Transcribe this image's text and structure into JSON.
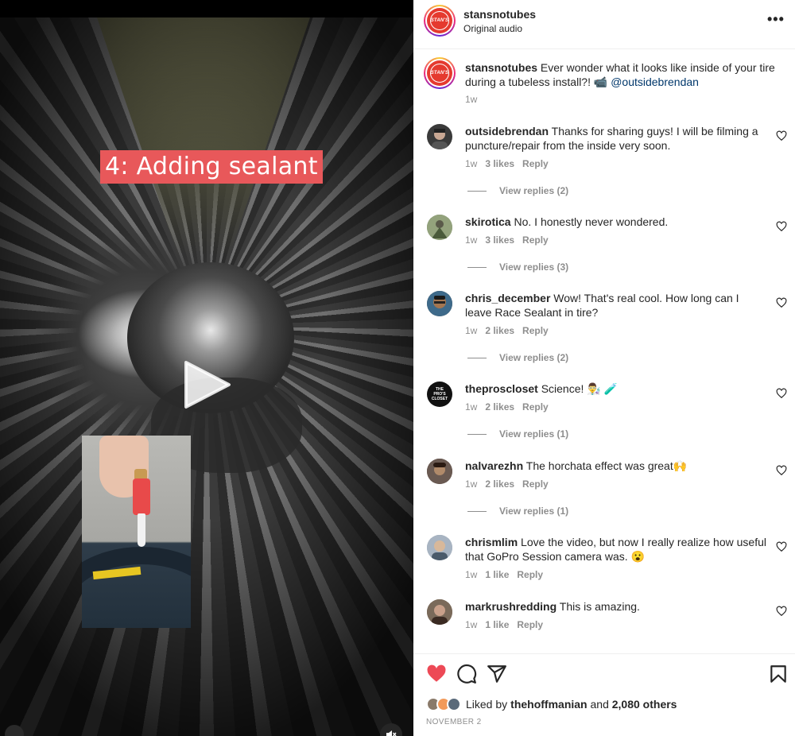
{
  "video": {
    "caption": "4: Adding sealant",
    "play_icon": "play-icon",
    "mute_icon": "mute-icon"
  },
  "header": {
    "username": "stansnotubes",
    "audio": "Original audio",
    "avatar_text": "STAN'S",
    "more_icon": "more-options-icon",
    "more_label": "•••"
  },
  "caption": {
    "username": "stansnotubes",
    "text": " Ever wonder what it looks like inside of your tire during a tubeless install?! 📹 ",
    "mention": "@outsidebrendan",
    "time": "1w"
  },
  "comments": [
    {
      "username": "outsidebrendan",
      "text": " Thanks for sharing guys! I will be filming a puncture/repair from the inside very soon.",
      "time": "1w",
      "likes": "3 likes",
      "reply": "Reply",
      "view_replies": "View replies (2)",
      "avatar_color": "#3a3a3a"
    },
    {
      "username": "skirotica",
      "text": " No. I honestly never wondered.",
      "time": "1w",
      "likes": "3 likes",
      "reply": "Reply",
      "view_replies": "View replies (3)",
      "avatar_color": "#7b8a6a"
    },
    {
      "username": "chris_december",
      "text": " Wow! That's real cool. How long can I leave Race Sealant in tire?",
      "time": "1w",
      "likes": "2 likes",
      "reply": "Reply",
      "view_replies": "View replies (2)",
      "avatar_color": "#5a4a3a"
    },
    {
      "username": "theproscloset",
      "text": " Science! 👨‍🔬 🧪",
      "time": "1w",
      "likes": "2 likes",
      "reply": "Reply",
      "view_replies": "View replies (1)",
      "avatar_color": "#111111",
      "avatar_text": "THE PRO'S CLOSET"
    },
    {
      "username": "nalvarezhn",
      "text": " The horchata effect was great🙌",
      "time": "1w",
      "likes": "2 likes",
      "reply": "Reply",
      "view_replies": "View replies (1)",
      "avatar_color": "#4a3a36"
    },
    {
      "username": "chrismlim",
      "text": " Love the video, but now I really realize how useful that GoPro Session camera was. 😮",
      "time": "1w",
      "likes": "1 like",
      "reply": "Reply",
      "avatar_color": "#8a96a6"
    },
    {
      "username": "markrushredding",
      "text": " This is amazing.",
      "time": "1w",
      "likes": "1 like",
      "reply": "Reply",
      "avatar_color": "#6a5a4e"
    }
  ],
  "actions": {
    "like_icon": "heart-filled-icon",
    "comment_icon": "comment-icon",
    "share_icon": "share-icon",
    "save_icon": "bookmark-icon",
    "liked_prefix": "Liked by ",
    "liked_user": "thehoffmanian",
    "liked_and": " and ",
    "liked_others": "2,080 others",
    "date": "NOVEMBER 2"
  },
  "colors": {
    "like_red": "#ed4956",
    "brand_red": "#e53a2f",
    "caption_bg": "#e8585a",
    "muted_text": "#8e8e8e",
    "link": "#00376b"
  }
}
